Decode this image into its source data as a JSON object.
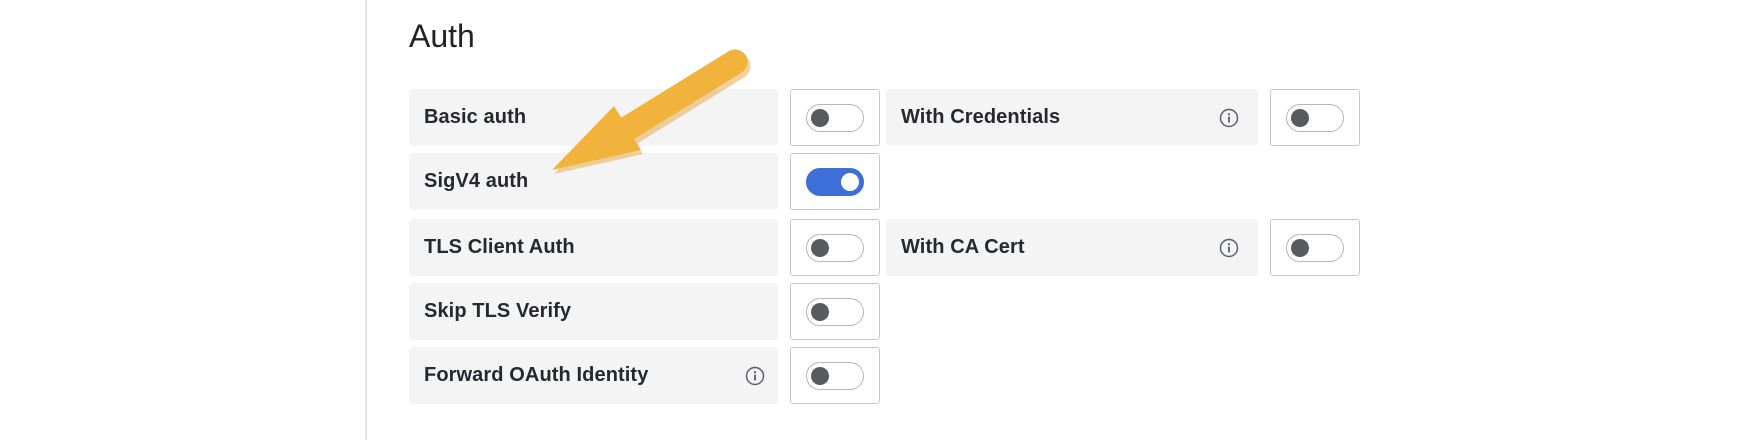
{
  "section": {
    "title": "Auth"
  },
  "rows": [
    {
      "label": "Basic auth",
      "enabled": false,
      "info": false
    },
    {
      "label": "SigV4 auth",
      "enabled": true,
      "info": false
    },
    {
      "label": "TLS Client Auth",
      "enabled": false,
      "info": false
    },
    {
      "label": "Skip TLS Verify",
      "enabled": false,
      "info": false
    },
    {
      "label": "Forward OAuth Identity",
      "enabled": false,
      "info": true
    }
  ],
  "side_rows": [
    {
      "label": "With Credentials",
      "enabled": false,
      "info": true
    },
    {
      "label": "With CA Cert",
      "enabled": false,
      "info": true
    }
  ],
  "colors": {
    "toggle_on": "#3e6fd8",
    "toggle_off_knob": "#585a60",
    "label_bg": "#f4f4f5",
    "annotation_arrow": "#f2b33d"
  },
  "icons": {
    "info": "info-circle-icon",
    "annotation": "arrow-annotation-icon"
  }
}
